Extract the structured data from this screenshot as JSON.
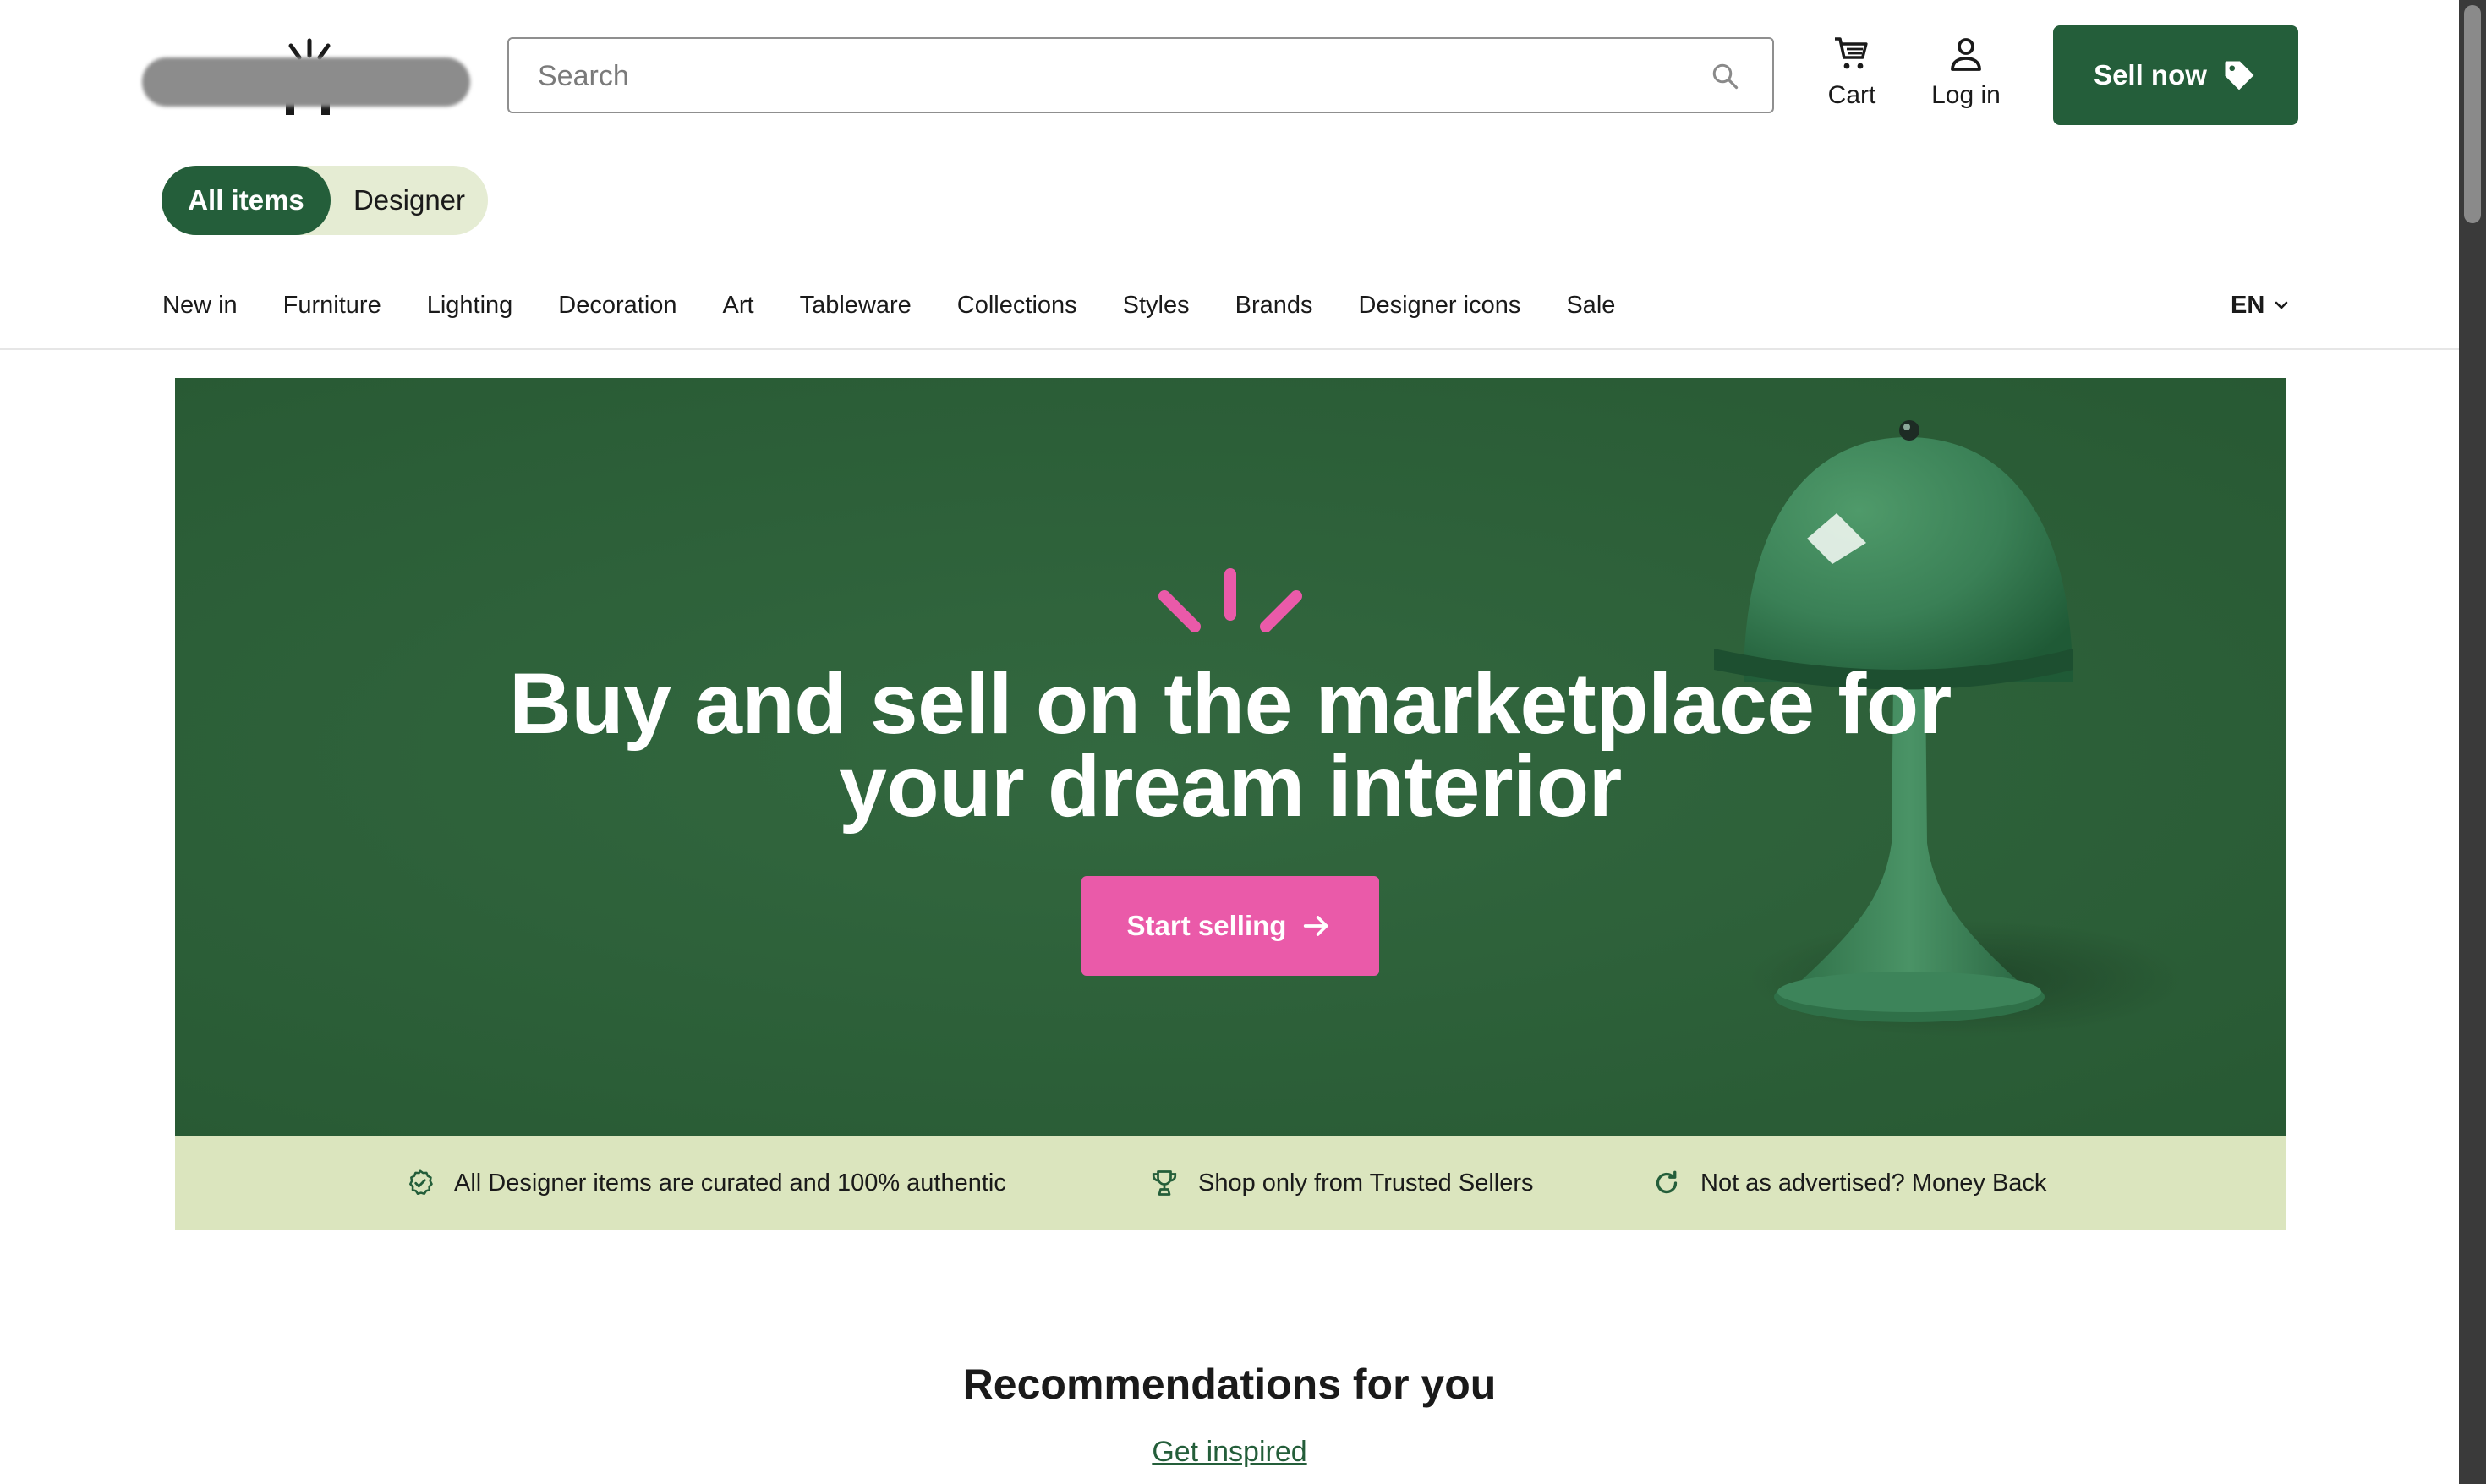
{
  "header": {
    "search_placeholder": "Search",
    "cart_label": "Cart",
    "login_label": "Log in",
    "sell_label": "Sell now"
  },
  "toggle": {
    "active_label": "All items",
    "inactive_label": "Designer"
  },
  "nav": {
    "items": [
      "New in",
      "Furniture",
      "Lighting",
      "Decoration",
      "Art",
      "Tableware",
      "Collections",
      "Styles",
      "Brands",
      "Designer icons",
      "Sale"
    ],
    "language": "EN"
  },
  "hero": {
    "title_line1": "Buy and sell on the marketplace for",
    "title_line2": "your dream interior",
    "cta_label": "Start selling"
  },
  "trust": {
    "items": [
      {
        "icon": "verified-badge-icon",
        "text": "All Designer items are curated and 100% authentic"
      },
      {
        "icon": "trophy-icon",
        "text": "Shop only from Trusted Sellers"
      },
      {
        "icon": "refresh-icon",
        "text": "Not as advertised? Money Back"
      }
    ]
  },
  "recommendations": {
    "title": "Recommendations for you",
    "link_label": "Get inspired"
  },
  "colors": {
    "brand_green": "#245e3a",
    "hero_green": "#2c6339",
    "accent_pink": "#ea5aa9",
    "trust_bar": "#dbe5be"
  }
}
